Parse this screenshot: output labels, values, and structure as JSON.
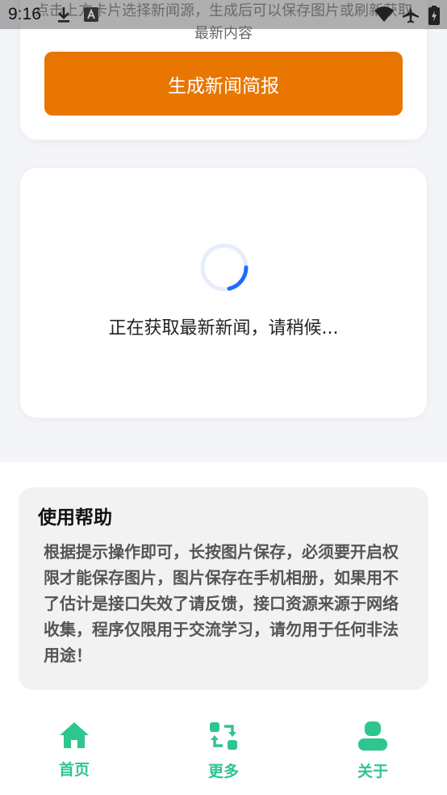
{
  "status_bar": {
    "time": "9:16",
    "icons": [
      "download-icon",
      "font-a-icon",
      "wifi-icon",
      "airplane-icon",
      "battery-icon"
    ]
  },
  "top_card": {
    "hint": "点击上方卡片选择新闻源，生成后可以保存图片或刷新获取最新内容",
    "generate_button": "生成新闻简报"
  },
  "loading": {
    "text": "正在获取最新新闻，请稍候...",
    "spinner_color": "#1e6bff"
  },
  "help": {
    "title": "使用帮助",
    "body": "根据提示操作即可，长按图片保存，必须要开启权限才能保存图片，图片保存在手机相册，如果用不了估计是接口失效了请反馈，接口资源来源于网络收集，程序仅限用于交流学习，请勿用于任何非法用途！"
  },
  "bottom_nav": {
    "items": [
      {
        "label": "首页",
        "icon": "home-icon"
      },
      {
        "label": "更多",
        "icon": "refresh-arrows-icon"
      },
      {
        "label": "关于",
        "icon": "user-icon"
      }
    ],
    "accent": "#2ec58f"
  },
  "colors": {
    "button_orange": "#e87600",
    "page_bg": "#f4f5f9"
  }
}
